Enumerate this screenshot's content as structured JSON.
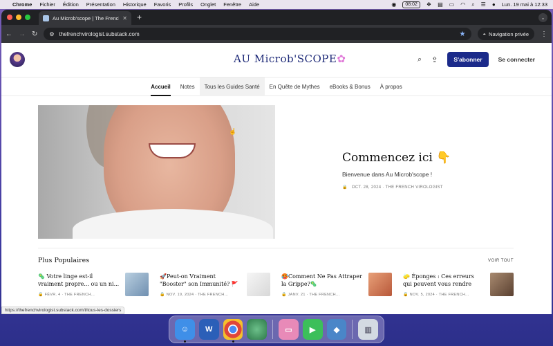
{
  "menubar": {
    "app": "Chrome",
    "items": [
      "Fichier",
      "Édition",
      "Présentation",
      "Historique",
      "Favoris",
      "Profils",
      "Onglet",
      "Fenêtre",
      "Aide"
    ],
    "clock_box": "08:02",
    "datetime": "Lun. 19 mai à 12:33"
  },
  "browser": {
    "tab_title": "Au Microb'scope | The French",
    "url": "thefrenchvirologist.substack.com",
    "private_label": "Navigation privée"
  },
  "site": {
    "logo_text": "AU Microb'SCOPE",
    "subscribe_label": "S'abonner",
    "signin_label": "Se connecter",
    "nav": [
      "Accueil",
      "Notes",
      "Tous les Guides Santé",
      "En Quête de Mythes",
      "eBooks & Bonus",
      "À propos"
    ]
  },
  "hero": {
    "title": "Commencez ici 👇",
    "subtitle": "Bienvenue dans Au Microb'scope !",
    "meta": "OCT. 28, 2024 · THE FRENCH VIROLOGIST"
  },
  "popular": {
    "heading": "Plus Populaires",
    "see_all": "VOIR TOUT",
    "posts": [
      {
        "title": "🦠 Votre linge est-il vraiment propre... ou un ni...",
        "meta": "FÉVR. 4 · THE FRENCH...",
        "thumb_color": "#8fb0c8"
      },
      {
        "title": "🚀Peut-on Vraiment \"Booster\" son Immunité? 🚩",
        "meta": "NOV. 19, 2024 · THE FRENCH...",
        "thumb_color": "#e6e6e6"
      },
      {
        "title": "🥵Comment Ne Pas Attraper la Grippe?🦠",
        "meta": "JANV. 21 · THE FRENCH...",
        "thumb_color": "#d2784c"
      },
      {
        "title": "🧽 Éponges : Ces erreurs qui peuvent vous rendre malad...",
        "meta": "NOV. 5, 2024 · THE FRENCH...",
        "thumb_color": "#8a6a58"
      }
    ]
  },
  "status_url": "https://thefrenchvirologist.substack.com/t/tous-les-dossiers",
  "dock": [
    {
      "name": "finder",
      "color": "#3f8fe8",
      "glyph": "☺"
    },
    {
      "name": "word",
      "color": "#2b5fb8",
      "glyph": "W"
    },
    {
      "name": "chrome",
      "color": "#e0463a",
      "glyph": "◉"
    },
    {
      "name": "globe",
      "color": "#3c9a5c",
      "glyph": "◐"
    },
    {
      "name": "app-pink",
      "color": "#e88ab8",
      "glyph": "▭"
    },
    {
      "name": "facetime",
      "color": "#3cbf5a",
      "glyph": "▶"
    },
    {
      "name": "app-blue",
      "color": "#4a86c8",
      "glyph": "◆"
    },
    {
      "name": "trash",
      "color": "#c8cfd8",
      "glyph": "🗑"
    }
  ]
}
